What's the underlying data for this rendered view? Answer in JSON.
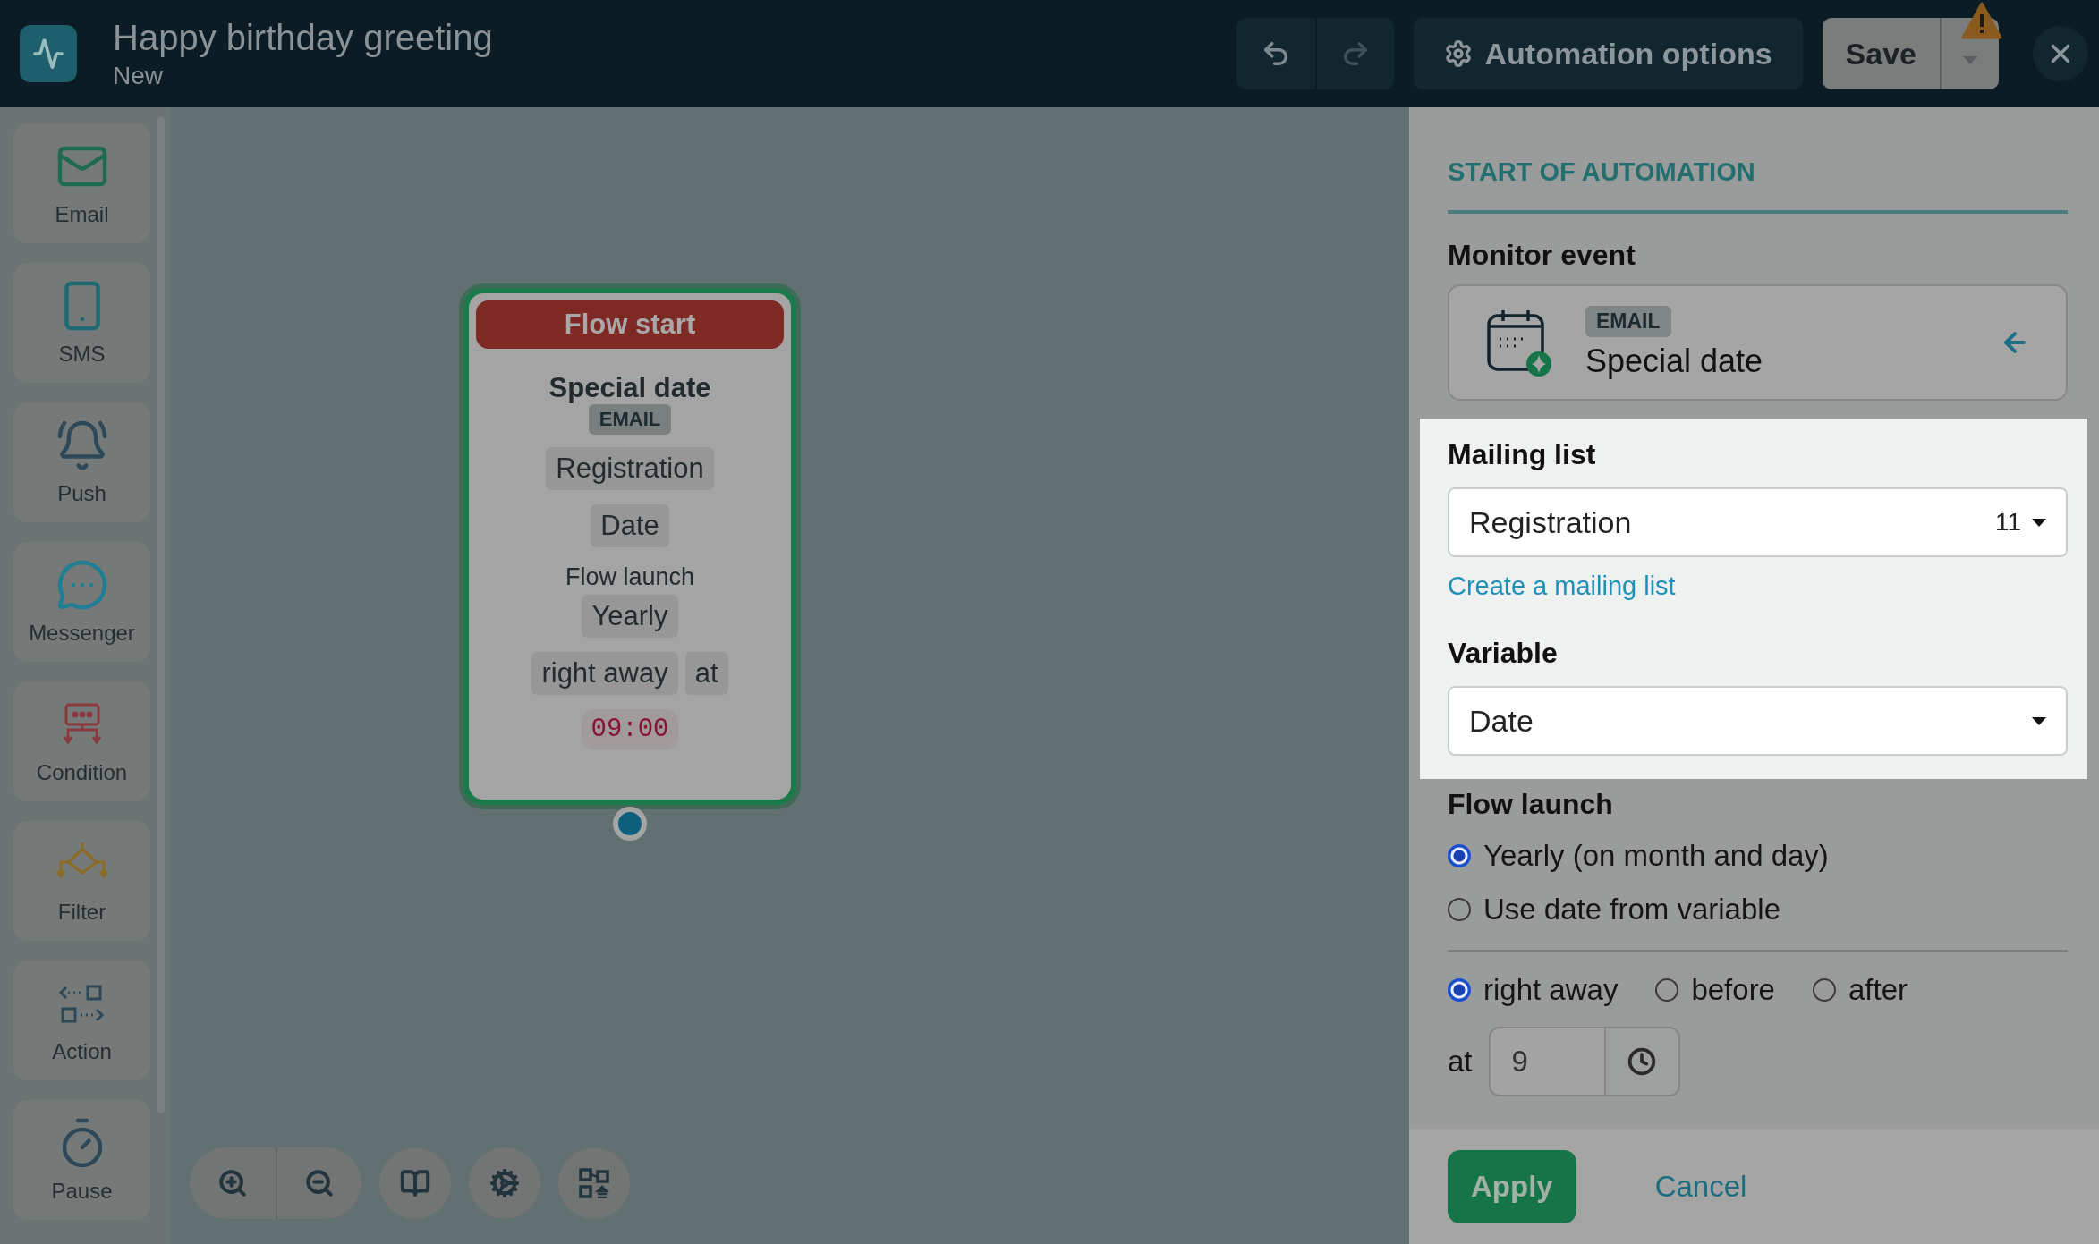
{
  "header": {
    "title": "Happy birthday greeting",
    "subtitle": "New",
    "options_button": "Automation options",
    "save_button": "Save"
  },
  "toolbox": [
    {
      "label": "Email",
      "kind": "email"
    },
    {
      "label": "SMS",
      "kind": "sms"
    },
    {
      "label": "Push",
      "kind": "push"
    },
    {
      "label": "Messenger",
      "kind": "messenger"
    },
    {
      "label": "Condition",
      "kind": "condition"
    },
    {
      "label": "Filter",
      "kind": "filter"
    },
    {
      "label": "Action",
      "kind": "action"
    },
    {
      "label": "Pause",
      "kind": "pause"
    }
  ],
  "node": {
    "title": "Flow start",
    "event": "Special date",
    "channel": "EMAIL",
    "list": "Registration",
    "variable": "Date",
    "launch_label": "Flow launch",
    "launch": "Yearly",
    "timing": [
      "right away",
      "at"
    ],
    "time": "09:00"
  },
  "panel": {
    "heading": "START OF AUTOMATION",
    "monitor_label": "Monitor event",
    "event": {
      "channel": "EMAIL",
      "name": "Special date"
    },
    "mailing_list": {
      "label": "Mailing list",
      "value": "Registration",
      "count": "11",
      "link": "Create a mailing list"
    },
    "variable": {
      "label": "Variable",
      "value": "Date"
    },
    "flow_launch": {
      "label": "Flow launch",
      "options": [
        {
          "label": "Yearly (on month and day)",
          "selected": true
        },
        {
          "label": "Use date from variable",
          "selected": false
        }
      ]
    },
    "timing": {
      "options": [
        {
          "label": "right away",
          "selected": true
        },
        {
          "label": "before",
          "selected": false
        },
        {
          "label": "after",
          "selected": false
        }
      ],
      "at_label": "at",
      "hour": "9"
    },
    "apply_button": "Apply",
    "cancel_button": "Cancel"
  }
}
